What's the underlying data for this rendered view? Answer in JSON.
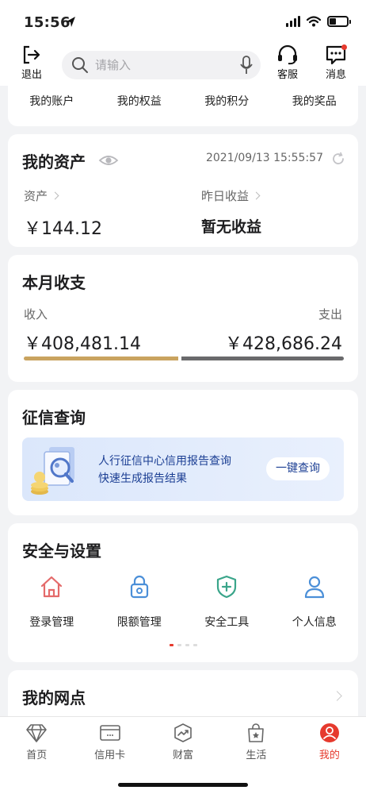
{
  "status_bar": {
    "time": "15:56"
  },
  "header": {
    "logout_label": "退出",
    "search_placeholder": "请输入",
    "service_label": "客服",
    "messages_label": "消息"
  },
  "account_links": [
    "我的账户",
    "我的权益",
    "我的积分",
    "我的奖品"
  ],
  "assets": {
    "title": "我的资产",
    "timestamp": "2021/09/13 15:55:57",
    "asset_label": "资产",
    "asset_value": "￥144.12",
    "yesterday_label": "昨日收益",
    "yesterday_value": "暂无收益"
  },
  "monthly": {
    "title": "本月收支",
    "income_label": "收入",
    "income_value": "￥408,481.14",
    "expense_label": "支出",
    "expense_value": "￥428,686.24",
    "income_amount": 408481.14,
    "expense_amount": 428686.24,
    "income_color": "#c9a35f",
    "expense_color": "#6a6a6c"
  },
  "credit": {
    "title": "征信查询",
    "line1": "人行征信中心信用报告查询",
    "line2": "快速生成报告结果",
    "button": "一键查询"
  },
  "settings": {
    "title": "安全与设置",
    "items": [
      {
        "label": "登录管理",
        "icon": "house-icon",
        "color": "#e46a6a"
      },
      {
        "label": "限额管理",
        "icon": "lock-icon",
        "color": "#4b8fd8"
      },
      {
        "label": "安全工具",
        "icon": "shield-plus-icon",
        "color": "#3aa58a"
      },
      {
        "label": "个人信息",
        "icon": "person-icon",
        "color": "#4b8fd8"
      }
    ]
  },
  "branch": {
    "title": "我的网点"
  },
  "tabs": [
    {
      "label": "首页",
      "icon": "diamond-icon"
    },
    {
      "label": "信用卡",
      "icon": "credit-card-icon"
    },
    {
      "label": "财富",
      "icon": "wealth-icon"
    },
    {
      "label": "生活",
      "icon": "shopping-bag-icon"
    },
    {
      "label": "我的",
      "icon": "profile-icon",
      "active": true
    }
  ],
  "colors": {
    "accent": "#e63a2e",
    "banner_text": "#1c3f94"
  }
}
